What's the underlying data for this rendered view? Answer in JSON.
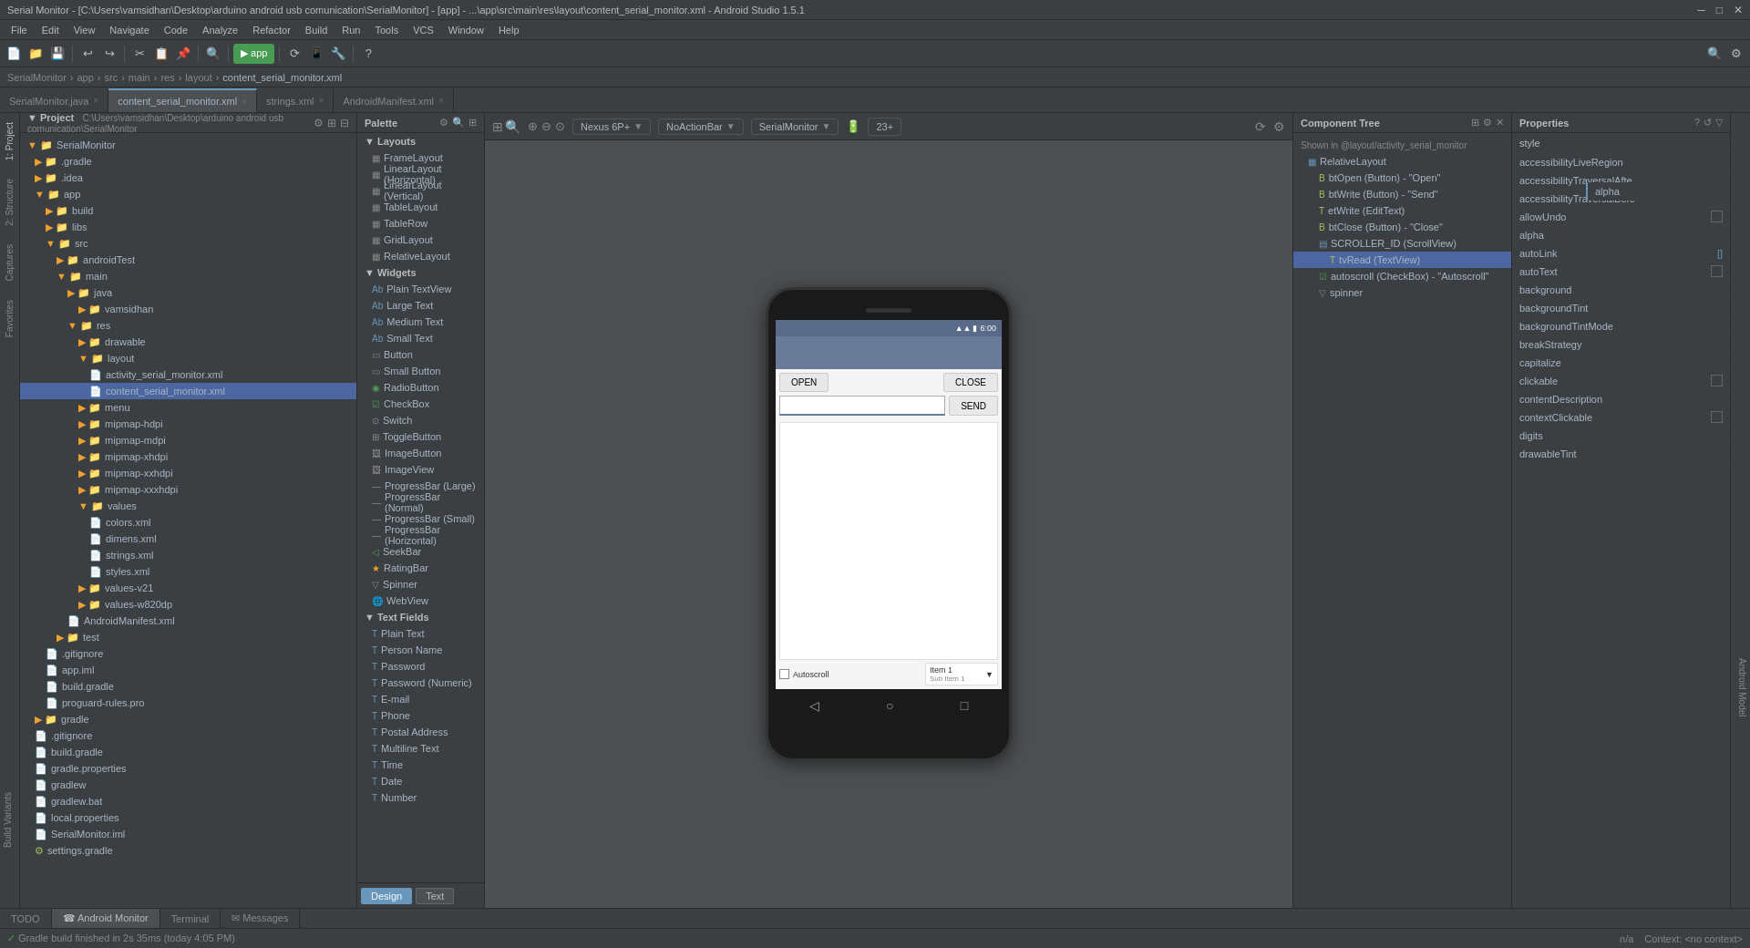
{
  "titleBar": {
    "title": "Serial Monitor - [C:\\Users\\vamsidhan\\Desktop\\arduino android usb comunication\\SerialMonitor] - [app] - ...\\app\\src\\main\\res\\layout\\content_serial_monitor.xml - Android Studio 1.5.1",
    "minimize": "─",
    "maximize": "□",
    "close": "✕"
  },
  "menuBar": {
    "items": [
      "File",
      "Edit",
      "View",
      "Navigate",
      "Code",
      "Analyze",
      "Refactor",
      "Build",
      "Run",
      "Tools",
      "VCS",
      "Window",
      "Help"
    ]
  },
  "projectTabs": {
    "items": [
      "▼ Project",
      "▼ Structure",
      "▼ Captures",
      "▼ Favorites",
      "▼ Build Variants"
    ]
  },
  "editorTabs": [
    {
      "label": "SerialMonitor",
      "active": false
    },
    {
      "label": "app",
      "active": false
    },
    {
      "label": "◎ src",
      "active": false
    },
    {
      "label": "main",
      "active": false
    },
    {
      "label": "res",
      "active": false
    },
    {
      "label": "layout",
      "active": false
    },
    {
      "label": "content_serial_monitor.xml",
      "active": true
    }
  ],
  "fileTabs": [
    {
      "label": "SerialMonitor.java ×",
      "active": false
    },
    {
      "label": "content_serial_monitor.xml ×",
      "active": true
    },
    {
      "label": "strings.xml ×",
      "active": false
    },
    {
      "label": "AndroidManifest.xml ×",
      "active": false
    }
  ],
  "projectPanel": {
    "header": "Project",
    "tree": [
      {
        "indent": 0,
        "icon": "📁",
        "label": "SerialMonitor",
        "type": "project"
      },
      {
        "indent": 1,
        "icon": "📁",
        "label": ".gradle",
        "type": "folder"
      },
      {
        "indent": 1,
        "icon": "📁",
        "label": ".idea",
        "type": "folder"
      },
      {
        "indent": 1,
        "icon": "📁",
        "label": "app",
        "type": "folder",
        "expanded": true
      },
      {
        "indent": 2,
        "icon": "📁",
        "label": "build",
        "type": "folder"
      },
      {
        "indent": 2,
        "icon": "📁",
        "label": "libs",
        "type": "folder"
      },
      {
        "indent": 2,
        "icon": "📁",
        "label": "src",
        "type": "folder",
        "expanded": true
      },
      {
        "indent": 3,
        "icon": "📁",
        "label": "androidTest",
        "type": "folder"
      },
      {
        "indent": 3,
        "icon": "📁",
        "label": "main",
        "type": "folder",
        "expanded": true
      },
      {
        "indent": 4,
        "icon": "📁",
        "label": "java",
        "type": "folder"
      },
      {
        "indent": 5,
        "icon": "📁",
        "label": "vamsidhan",
        "type": "folder"
      },
      {
        "indent": 4,
        "icon": "📁",
        "label": "res",
        "type": "folder",
        "expanded": true
      },
      {
        "indent": 5,
        "icon": "📁",
        "label": "drawable",
        "type": "folder"
      },
      {
        "indent": 5,
        "icon": "📁",
        "label": "layout",
        "type": "folder",
        "expanded": true
      },
      {
        "indent": 6,
        "icon": "📄",
        "label": "activity_serial_monitor.xml",
        "type": "xml"
      },
      {
        "indent": 6,
        "icon": "📄",
        "label": "content_serial_monitor.xml",
        "type": "xml",
        "selected": true
      },
      {
        "indent": 5,
        "icon": "📁",
        "label": "menu",
        "type": "folder"
      },
      {
        "indent": 5,
        "icon": "📁",
        "label": "mipmap-hdpi",
        "type": "folder"
      },
      {
        "indent": 5,
        "icon": "📁",
        "label": "mipmap-mdpi",
        "type": "folder"
      },
      {
        "indent": 5,
        "icon": "📁",
        "label": "mipmap-xhdpi",
        "type": "folder"
      },
      {
        "indent": 5,
        "icon": "📁",
        "label": "mipmap-xxhdpi",
        "type": "folder"
      },
      {
        "indent": 5,
        "icon": "📁",
        "label": "mipmap-xxxhdpi",
        "type": "folder"
      },
      {
        "indent": 5,
        "icon": "📁",
        "label": "values",
        "type": "folder",
        "expanded": true
      },
      {
        "indent": 6,
        "icon": "📄",
        "label": "colors.xml",
        "type": "xml"
      },
      {
        "indent": 6,
        "icon": "📄",
        "label": "dimens.xml",
        "type": "xml"
      },
      {
        "indent": 6,
        "icon": "📄",
        "label": "strings.xml",
        "type": "xml"
      },
      {
        "indent": 6,
        "icon": "📄",
        "label": "styles.xml",
        "type": "xml"
      },
      {
        "indent": 5,
        "icon": "📁",
        "label": "values-v21",
        "type": "folder"
      },
      {
        "indent": 5,
        "icon": "📁",
        "label": "values-w820dp",
        "type": "folder"
      },
      {
        "indent": 4,
        "icon": "📄",
        "label": "AndroidManifest.xml",
        "type": "xml"
      },
      {
        "indent": 3,
        "icon": "📁",
        "label": "test",
        "type": "folder"
      },
      {
        "indent": 2,
        "icon": "📄",
        "label": ".gitignore",
        "type": "file"
      },
      {
        "indent": 2,
        "icon": "📄",
        "label": "app.iml",
        "type": "file"
      },
      {
        "indent": 2,
        "icon": "📄",
        "label": "build.gradle",
        "type": "gradle"
      },
      {
        "indent": 2,
        "icon": "📄",
        "label": "proguard-rules.pro",
        "type": "file"
      },
      {
        "indent": 1,
        "icon": "📁",
        "label": "gradle",
        "type": "folder"
      },
      {
        "indent": 1,
        "icon": "📄",
        "label": ".gitignore",
        "type": "file"
      },
      {
        "indent": 1,
        "icon": "📄",
        "label": "build.gradle",
        "type": "gradle"
      },
      {
        "indent": 1,
        "icon": "📄",
        "label": "gradle.properties",
        "type": "file"
      },
      {
        "indent": 1,
        "icon": "📄",
        "label": "gradlew",
        "type": "file"
      },
      {
        "indent": 1,
        "icon": "📄",
        "label": "gradlew.bat",
        "type": "file"
      },
      {
        "indent": 1,
        "icon": "📄",
        "label": "local.properties",
        "type": "file"
      },
      {
        "indent": 1,
        "icon": "📄",
        "label": "SerialMonitor.iml",
        "type": "file"
      },
      {
        "indent": 1,
        "icon": "⚙",
        "label": "settings.gradle",
        "type": "gradle"
      }
    ]
  },
  "palette": {
    "header": "Palette",
    "sections": [
      {
        "name": "Layouts",
        "items": [
          "FrameLayout",
          "LinearLayout (Horizontal)",
          "LinearLayout (Vertical)",
          "TableLayout",
          "TableRow",
          "GridLayout",
          "RelativeLayout"
        ]
      },
      {
        "name": "Widgets",
        "items": [
          "Plain TextView",
          "Large Text",
          "Medium Text",
          "Small Text",
          "Button",
          "Small Button",
          "RadioButton",
          "CheckBox",
          "Switch",
          "ToggleButton",
          "ImageButton",
          "ImageView",
          "ProgressBar (Large)",
          "ProgressBar (Normal)",
          "ProgressBar (Small)",
          "ProgressBar (Horizontal)",
          "SeekBar",
          "RatingBar",
          "Spinner",
          "WebView"
        ]
      },
      {
        "name": "Text Fields",
        "items": [
          "Plain Text",
          "Person Name",
          "Password",
          "Password (Numeric)",
          "E-mail",
          "Phone",
          "Postal Address",
          "Multiline Text",
          "Time",
          "Date",
          "Number"
        ]
      }
    ]
  },
  "designToolbar": {
    "device": "Nexus 6P+",
    "theme": "NoActionBar",
    "config": "SerialMonitor",
    "api": "23+"
  },
  "phone": {
    "time": "6:00",
    "openBtn": "OPEN",
    "closeBtn": "CLOSE",
    "sendBtn": "SEND",
    "autoscrollLabel": "Autoscroll",
    "spinnerItem": "Item 1",
    "spinnerSubItem": "Sub Item 1",
    "editTextHint": ""
  },
  "designTabs": {
    "design": "Design",
    "text": "Text"
  },
  "componentTree": {
    "header": "Component Tree",
    "nodes": [
      {
        "indent": 0,
        "label": "Shown in @layout/activity_serial_monitor",
        "icon": ""
      },
      {
        "indent": 1,
        "label": "RelativeLayout",
        "icon": "▦"
      },
      {
        "indent": 2,
        "label": "btOpen (Button) - \"Open\"",
        "icon": "B"
      },
      {
        "indent": 2,
        "label": "btWrite (Button) - \"Send\"",
        "icon": "B"
      },
      {
        "indent": 2,
        "label": "etWrite (EditText)",
        "icon": "T"
      },
      {
        "indent": 2,
        "label": "btClose (Button) - \"Close\"",
        "icon": "B"
      },
      {
        "indent": 2,
        "label": "SCROLLER_ID (ScrollView)",
        "icon": "▤"
      },
      {
        "indent": 3,
        "label": "tvRead (TextView)",
        "icon": "T",
        "selected": true
      },
      {
        "indent": 2,
        "label": "autoscroll (CheckBox) - \"Autoscroll\"",
        "icon": "☑"
      },
      {
        "indent": 2,
        "label": "spinner",
        "icon": "▽"
      }
    ]
  },
  "properties": {
    "header": "Properties",
    "styleHeader": "style",
    "rows": [
      {
        "name": "accessibilityLiveRegion",
        "value": ""
      },
      {
        "name": "accessibilityTraversalAfte",
        "value": ""
      },
      {
        "name": "accessibilityTraversalBefc",
        "value": ""
      },
      {
        "name": "allowUndo",
        "value": "checkbox",
        "checked": false
      },
      {
        "name": "alpha",
        "value": ""
      },
      {
        "name": "autoLink",
        "value": "[]"
      },
      {
        "name": "autoText",
        "value": "checkbox",
        "checked": false
      },
      {
        "name": "background",
        "value": ""
      },
      {
        "name": "backgroundTint",
        "value": ""
      },
      {
        "name": "backgroundTintMode",
        "value": ""
      },
      {
        "name": "breakStrategy",
        "value": ""
      },
      {
        "name": "capitalize",
        "value": ""
      },
      {
        "name": "clickable",
        "value": "checkbox",
        "checked": false
      },
      {
        "name": "contentDescription",
        "value": ""
      },
      {
        "name": "contextClickable",
        "value": "checkbox",
        "checked": false
      },
      {
        "name": "digits",
        "value": ""
      },
      {
        "name": "drawableTint",
        "value": ""
      }
    ]
  },
  "statusBar": {
    "left": "TODO  ☎ Android Monitor  Terminal  ✉ Messages",
    "gradle": "Gradle build finished in 2s 35ms (today 4:05 PM)",
    "right": "n/a  Context: <no context>"
  },
  "bottomTabs": [
    "TODO",
    "Android Monitor",
    "Terminal",
    "Messages"
  ]
}
